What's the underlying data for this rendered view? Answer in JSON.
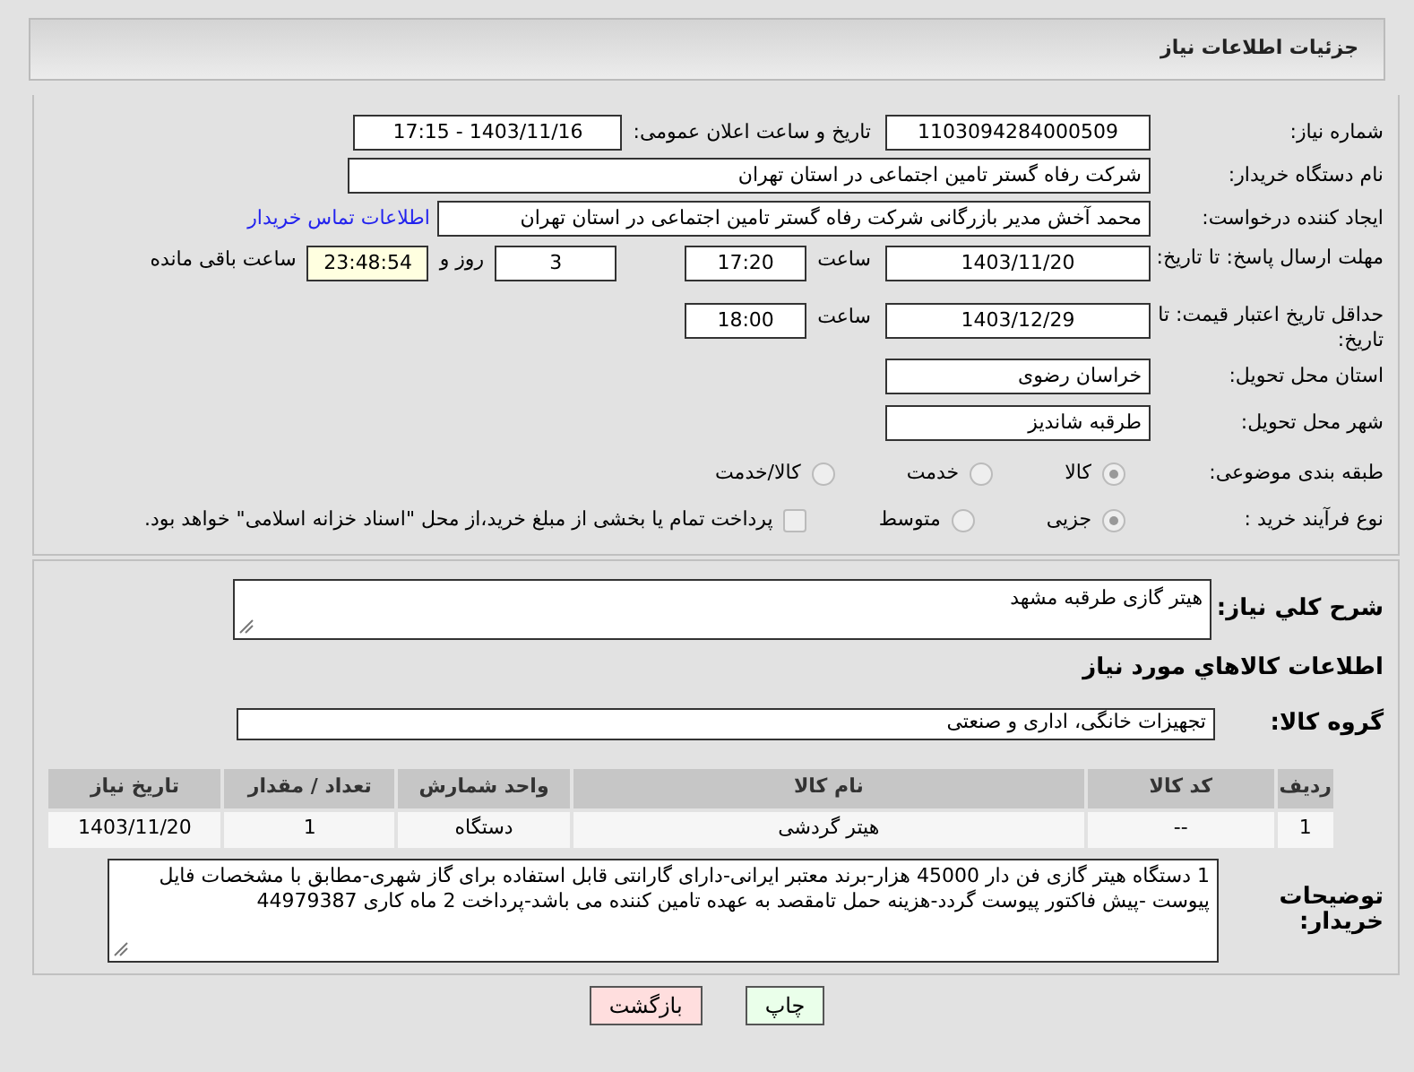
{
  "header": {
    "title": "جزئیات اطلاعات نیاز"
  },
  "need_number": {
    "label": "شماره نیاز:",
    "value": "1103094284000509"
  },
  "announce": {
    "label": "تاریخ و ساعت اعلان عمومی:",
    "value": "1403/11/16 - 17:15"
  },
  "buyer_org": {
    "label": "نام دستگاه خریدار:",
    "value": "شرکت رفاه گستر تامین اجتماعی در استان تهران"
  },
  "requester": {
    "label": "ایجاد کننده درخواست:",
    "value": "محمد آخش مدیر بازرگانی شرکت رفاه گستر تامین اجتماعی در استان تهران",
    "link": "اطلاعات تماس خریدار"
  },
  "deadline": {
    "label": "مهلت ارسال پاسخ: تا تاریخ:",
    "date": "1403/11/20",
    "time_label": "ساعت",
    "time": "17:20",
    "days": "3",
    "days_label": "روز و",
    "remaining": "23:48:54",
    "remaining_label": "ساعت باقی مانده"
  },
  "price_validity": {
    "label": "حداقل تاریخ اعتبار قیمت: تا تاریخ:",
    "date": "1403/12/29",
    "time_label": "ساعت",
    "time": "18:00"
  },
  "province": {
    "label": "استان محل تحویل:",
    "value": "خراسان رضوی"
  },
  "city": {
    "label": "شهر محل تحویل:",
    "value": "طرقبه شاندیز"
  },
  "category": {
    "label": "طبقه بندی موضوعی:",
    "options": [
      {
        "label": "کالا",
        "selected": true
      },
      {
        "label": "خدمت",
        "selected": false
      },
      {
        "label": "کالا/خدمت",
        "selected": false
      }
    ]
  },
  "process": {
    "label": "نوع فرآیند خرید :",
    "options": [
      {
        "label": "جزیی",
        "selected": true
      },
      {
        "label": "متوسط",
        "selected": false
      }
    ],
    "payment_note": {
      "label": "پرداخت تمام یا بخشی از مبلغ خرید،از محل \"اسناد خزانه اسلامی\" خواهد بود.",
      "checked": false
    }
  },
  "description": {
    "label": "شرح کلي نياز:",
    "value": "هیتر گازی طرقبه مشهد"
  },
  "goods_heading": "اطلاعات کالاهاي مورد نياز",
  "goods_group": {
    "label": "گروه کالا:",
    "value": "تجهیزات خانگی، اداری و صنعتی"
  },
  "table": {
    "columns": [
      "رديف",
      "کد کالا",
      "نام کالا",
      "واحد شمارش",
      "تعداد / مقدار",
      "تاريخ نياز"
    ],
    "rows": [
      [
        "1",
        "--",
        "هیتر گردشی",
        "دستگاه",
        "1",
        "1403/11/20"
      ]
    ]
  },
  "buyer_notes": {
    "label": "توضیحات خریدار:",
    "value": "1 دستگاه هیتر گازی فن دار 45000 هزار-برند معتبر ایرانی-دارای گارانتی قابل استفاده برای گاز شهری-مطابق با مشخصات فایل پیوست -پیش فاکتور پیوست گردد-هزینه حمل تامقصد به عهده تامین کننده می باشد-پرداخت 2 ماه کاری 44979387"
  },
  "buttons": [
    {
      "label": "چاپ",
      "kind": "print"
    },
    {
      "label": "بازگشت",
      "kind": "back"
    }
  ]
}
